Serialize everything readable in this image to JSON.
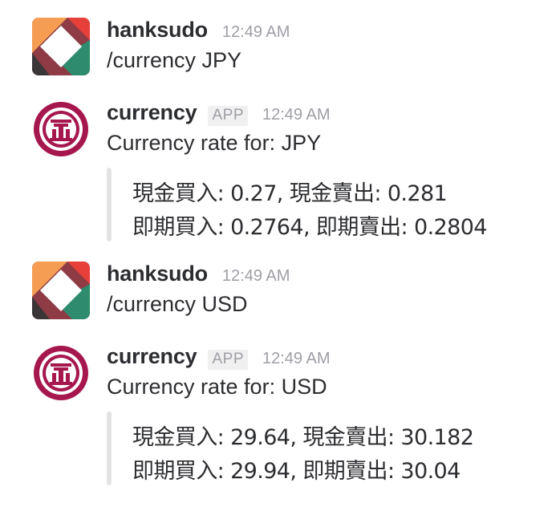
{
  "messages": [
    {
      "author": "hanksudo",
      "time": "12:49 AM",
      "text": "/currency JPY",
      "avatar_icon": "user-avatar-icon"
    },
    {
      "author": "currency",
      "badge": "APP",
      "time": "12:49 AM",
      "text": "Currency rate for: JPY",
      "avatar_icon": "bank-logo-icon",
      "attachment": {
        "line1": "現金買入: 0.27, 現金賣出: 0.281",
        "line2": "即期買入: 0.2764, 即期賣出: 0.2804"
      }
    },
    {
      "author": "hanksudo",
      "time": "12:49 AM",
      "text": "/currency USD",
      "avatar_icon": "user-avatar-icon"
    },
    {
      "author": "currency",
      "badge": "APP",
      "time": "12:49 AM",
      "text": "Currency rate for: USD",
      "avatar_icon": "bank-logo-icon",
      "attachment": {
        "line1": "現金買入: 29.64, 現金賣出: 30.182",
        "line2": "即期買入: 29.94, 即期賣出: 30.04"
      }
    }
  ],
  "colors": {
    "bank_maroon": "#a6174e",
    "attachment_border": "#e3e3e3",
    "muted_text": "#9e9ea6",
    "avatar_orange": "#f59e53",
    "avatar_red": "#e7403a",
    "avatar_maroon": "#8e3b45",
    "avatar_teal": "#2e8b6e",
    "avatar_dark": "#3a3536"
  }
}
